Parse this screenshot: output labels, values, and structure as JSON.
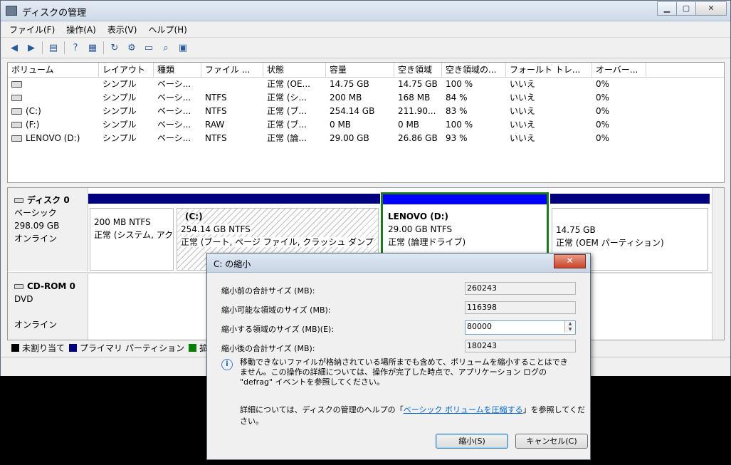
{
  "window": {
    "title": "ディスクの管理"
  },
  "menu": [
    "ファイル(F)",
    "操作(A)",
    "表示(V)",
    "ヘルプ(H)"
  ],
  "toolbar_icons": [
    "back-icon",
    "forward-icon",
    "console-tree-icon",
    "help-icon",
    "properties-icon",
    "refresh-icon",
    "settings-icon",
    "open-icon",
    "search-icon",
    "export-icon"
  ],
  "volume_list": {
    "headers": [
      "ボリューム",
      "レイアウト",
      "種類",
      "ファイル ...",
      "状態",
      "容量",
      "空き領域",
      "空き領域の...",
      "フォールト トレ...",
      "オーバー..."
    ],
    "rows": [
      [
        "",
        "シンプル",
        "ベーシ...",
        "",
        "正常 (OE...",
        "14.75 GB",
        "14.75 GB",
        "100 %",
        "いいえ",
        "0%"
      ],
      [
        "",
        "シンプル",
        "ベーシ...",
        "NTFS",
        "正常 (シ...",
        "200 MB",
        "168 MB",
        "84 %",
        "いいえ",
        "0%"
      ],
      [
        "(C:)",
        "シンプル",
        "ベーシ...",
        "NTFS",
        "正常 (ブ...",
        "254.14 GB",
        "211.90...",
        "83 %",
        "いいえ",
        "0%"
      ],
      [
        "(F:)",
        "シンプル",
        "ベーシ...",
        "RAW",
        "正常 (ブ...",
        "0 MB",
        "0 MB",
        "100 %",
        "いいえ",
        "0%"
      ],
      [
        "LENOVO (D:)",
        "シンプル",
        "ベーシ...",
        "NTFS",
        "正常 (論...",
        "29.00 GB",
        "26.86 GB",
        "93 %",
        "いいえ",
        "0%"
      ]
    ]
  },
  "disk0": {
    "name": "ディスク 0",
    "type": "ベーシック",
    "size": "298.09 GB",
    "status": "オンライン",
    "partitions": [
      {
        "title": "",
        "line1": "200 MB NTFS",
        "line2": "正常 (システム, アク"
      },
      {
        "title": "(C:)",
        "line1": "254.14 GB NTFS",
        "line2": "正常 (ブート, ページ ファイル, クラッシュ ダンプ"
      },
      {
        "title": "LENOVO  (D:)",
        "line1": "29.00 GB NTFS",
        "line2": "正常 (論理ドライブ)"
      },
      {
        "title": "",
        "line1": "14.75 GB",
        "line2": "正常 (OEM パーティション)"
      }
    ]
  },
  "cdrom0": {
    "name": "CD-ROM 0",
    "type": "DVD",
    "status": "オンライン"
  },
  "legend": [
    "未割り当て",
    "プライマリ パーティション",
    "拡"
  ],
  "legend_colors": [
    "#000000",
    "#00007f",
    "#008000"
  ],
  "dialog": {
    "title": "C: の縮小",
    "close_glyph": "✕",
    "fields": [
      {
        "label": "縮小前の合計サイズ (MB):",
        "value": "260243"
      },
      {
        "label": "縮小可能な領域のサイズ (MB):",
        "value": "116398"
      },
      {
        "label": "縮小する領域のサイズ (MB)(E):",
        "value": "80000"
      },
      {
        "label": "縮小後の合計サイズ (MB):",
        "value": "180243"
      }
    ],
    "info": "移動できないファイルが格納されている場所までも含めて、ボリュームを縮小することはできません。この操作の詳細については、操作が完了した時点で、アプリケーション ログの \"defrag\" イベントを参照してください。",
    "help_prefix": "詳細については、ディスクの管理のヘルプの「",
    "help_link": "ベーシック ボリュームを圧縮する",
    "help_suffix": "」を参照してください。",
    "shrink_button": "縮小(S)",
    "cancel_button": "キャンセル(C)"
  }
}
